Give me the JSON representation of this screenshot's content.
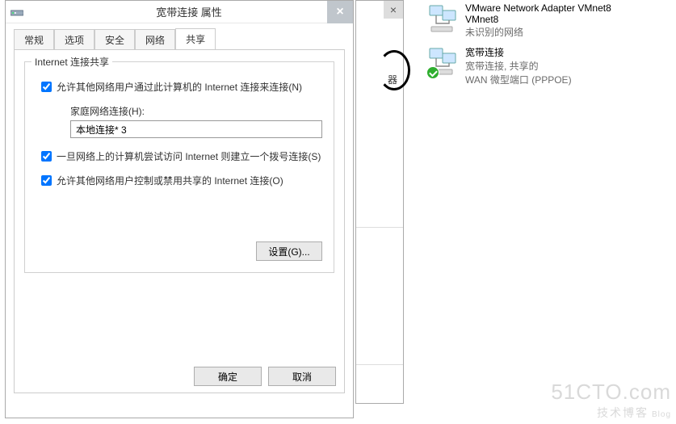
{
  "dialog": {
    "title": "宽带连接 属性",
    "tabs": [
      "常规",
      "选项",
      "安全",
      "网络",
      "共享"
    ],
    "active_tab_index": 4,
    "group_title": "Internet 连接共享",
    "check1_label": "允许其他网络用户通过此计算机的 Internet 连接来连接(N)",
    "check1_checked": true,
    "home_net_label": "家庭网络连接(H):",
    "home_net_value": "本地连接* 3",
    "check2_label": "一旦网络上的计算机尝试访问 Internet 则建立一个拨号连接(S)",
    "check2_checked": true,
    "check3_label": "允许其他网络用户控制或禁用共享的 Internet 连接(O)",
    "check3_checked": true,
    "settings_btn": "设置(G)...",
    "ok_btn": "确定",
    "cancel_btn": "取消"
  },
  "back_window": {
    "partial_text": "器"
  },
  "adapters": [
    {
      "name": "VMware Network Adapter VMnet8",
      "name_line2": "VMnet8",
      "sub": "未识别的网络",
      "icon": "net-adapter-icon",
      "status_ok": false
    },
    {
      "name": "宽带连接",
      "name_line2": "",
      "sub": "宽带连接, 共享的",
      "sub2": "WAN 微型端口 (PPPOE)",
      "icon": "net-adapter-icon",
      "status_ok": true
    }
  ],
  "watermark": {
    "line1": "51CTO.com",
    "line2": "技术博客",
    "line2b": "Blog"
  }
}
